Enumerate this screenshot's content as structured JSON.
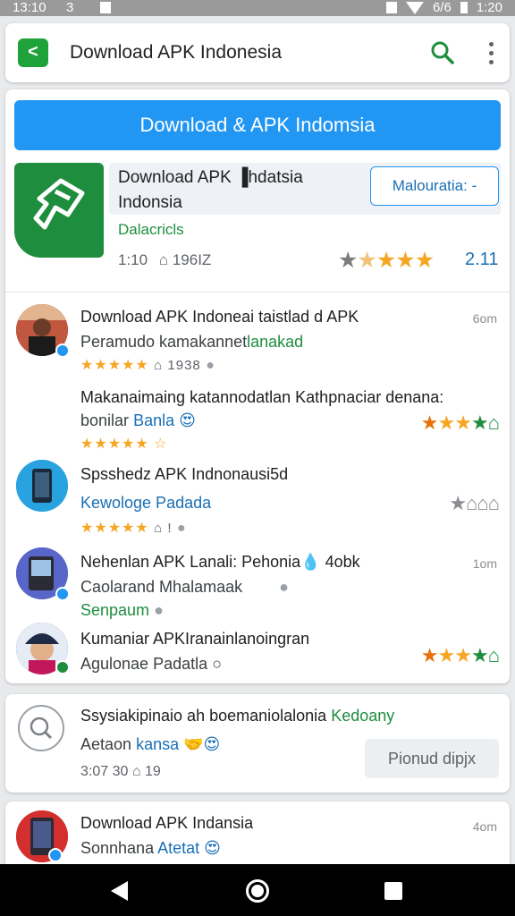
{
  "status_bar": {
    "time_left": "13:10",
    "indicator": "3",
    "battery": "6/6",
    "time_right": "1:20"
  },
  "app_bar": {
    "title": "Download APK Indonesia",
    "back_icon": "back-arrow-icon",
    "search_icon": "search-icon",
    "more_icon": "more-vert-icon"
  },
  "banner_button": "Download & APK Indomsia",
  "hero": {
    "title": "Download APK ▐hdatsia",
    "subtitle": "Indonsia",
    "developer": "Dalacricls",
    "meta_time": "1:10",
    "meta_size": "196IZ",
    "action_label": "Malouratia: -",
    "rating": "2.11",
    "stars": "★★★★★"
  },
  "items": [
    {
      "title": "Download APK Indoneai taistlad d APK",
      "sub_plain": "Peramudo kamakannet",
      "sub_blue": "lanakad",
      "stars": "★★★★★",
      "meta": "⌂ 1938",
      "time": "6om"
    },
    {
      "title": "Makanaimaing katannodatlan Kathpnaciar denana:",
      "sub_plain": "bonilar",
      "sub_blue": "Banla 😍",
      "stars": "★★★★★ ☆",
      "extra": "★★★★⌂"
    },
    {
      "title": "Spsshedz APK Indnonausi5d",
      "sub_blue": "Kewologe Padada",
      "stars": "★★★★★",
      "meta": "⌂ !",
      "extra": "★⌂⌂⌂"
    },
    {
      "title": "Nehenlan APK Lanali: Pehonia💧 4obk",
      "sub_plain": "Caolarand Mhalamaak",
      "sub_green": "Senpaum",
      "time": "1om"
    },
    {
      "title": "Kumaniar APKIranainlanoingran",
      "sub_plain": "Agulonae Padatla ○",
      "extra": "★★★★⌂"
    }
  ],
  "search_card": {
    "title_plain": "Ssysiakipinaio ah boemaniolalonia",
    "title_green": "Kedoany",
    "sub_plain": "Aetaon",
    "sub_blue": "kansa 🤝😍",
    "meta": "3:07    30 ⌂ 19",
    "button": "Pionud dipjx"
  },
  "bottom_item": {
    "title": "Download APK Indansia",
    "sub_plain": "Sonnhana",
    "sub_blue": "Atetat 😍",
    "time": "4om"
  },
  "colors": {
    "accent_blue": "#2196f3",
    "brand_green": "#1e8e3e",
    "star_gold": "#f5a623"
  }
}
